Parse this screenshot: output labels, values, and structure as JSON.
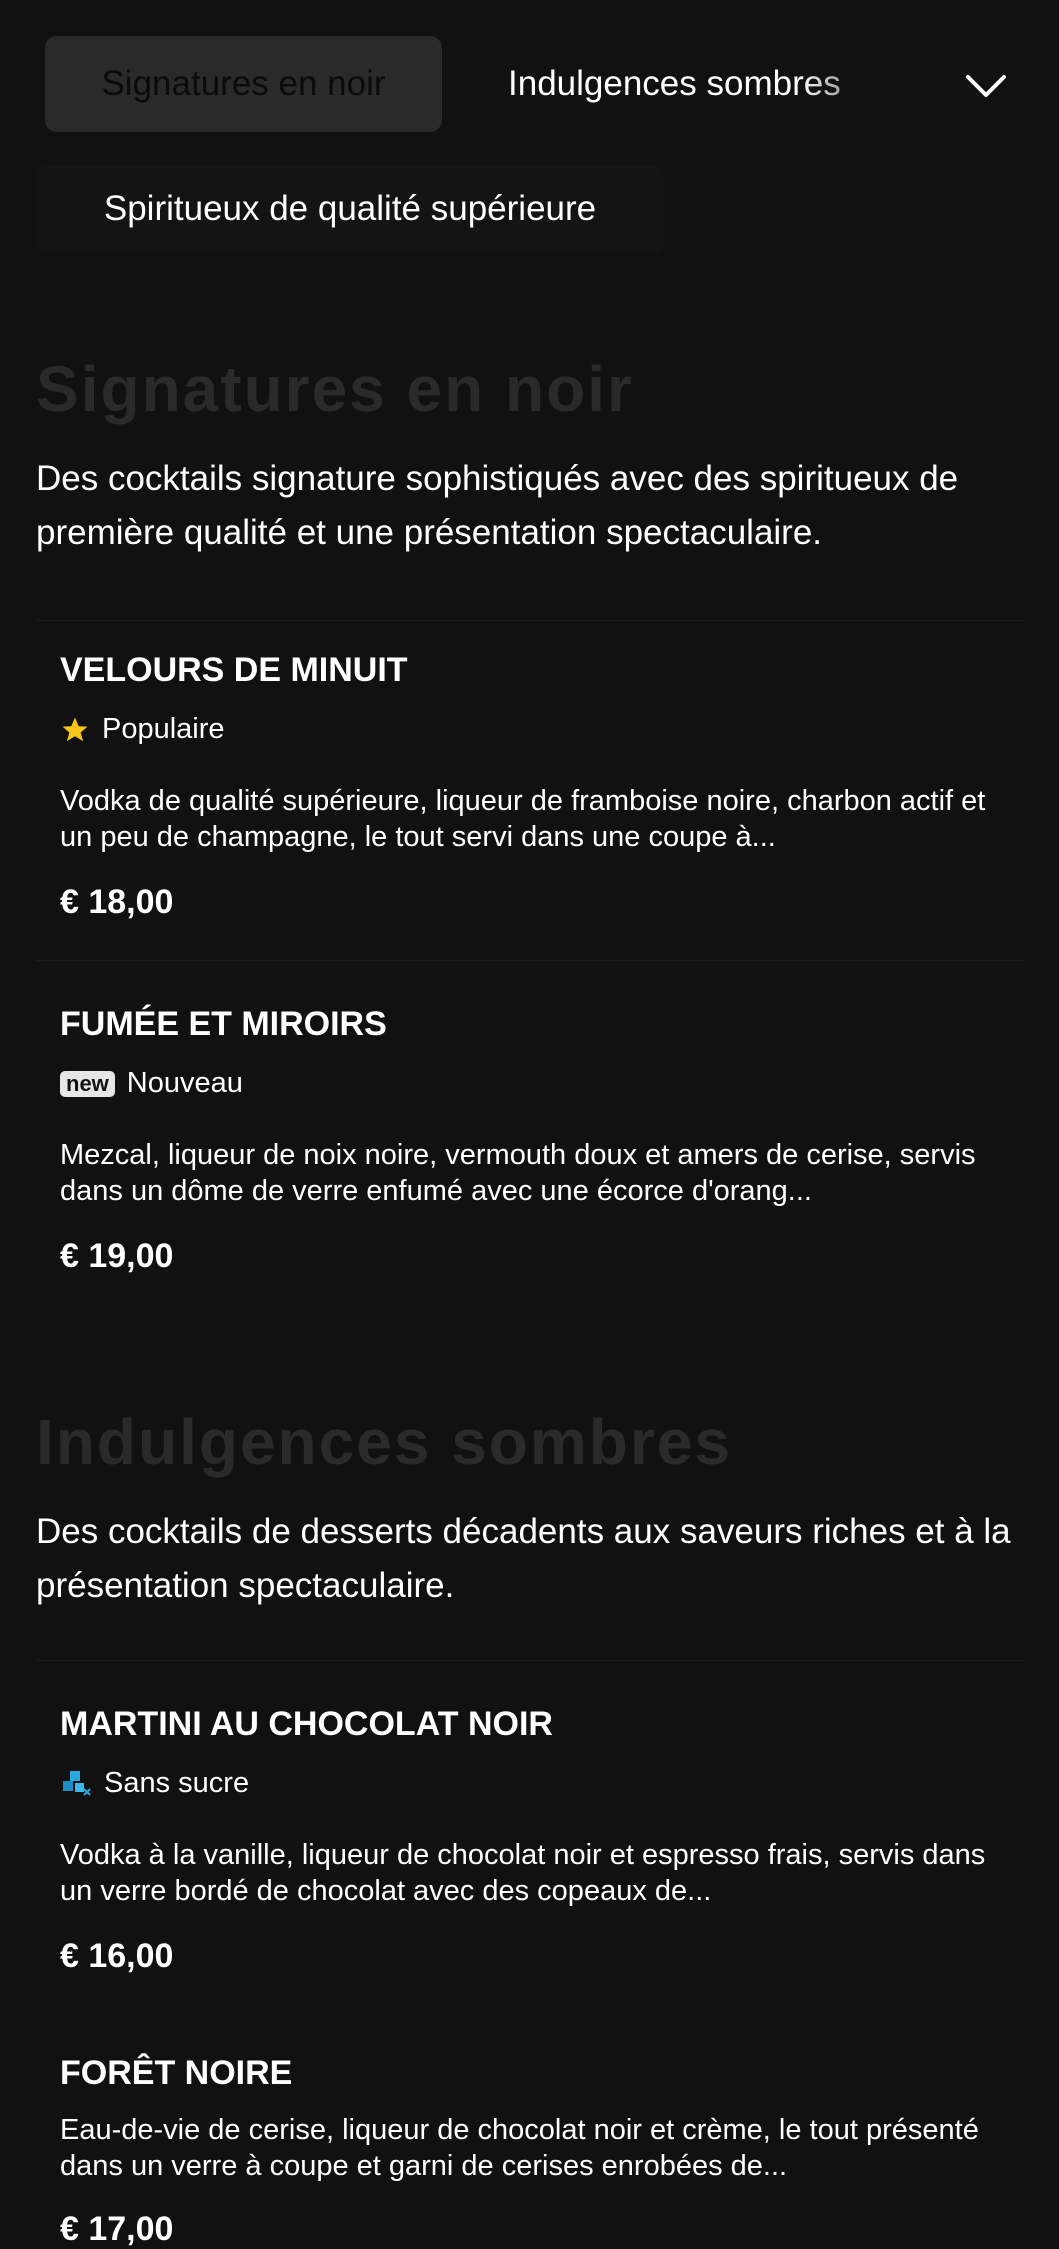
{
  "categories": {
    "tabs": [
      "Signatures en noir",
      "Indulgences sombres",
      "Spiritueux de qualité supérieure"
    ],
    "active_index": 0,
    "expand_icon": "chevron-down-icon"
  },
  "sections": [
    {
      "title": "Signatures en noir",
      "description": "Des cocktails signature sophistiqués avec des spiritueux de première qualité et une présentation spectaculaire.",
      "items": [
        {
          "name": "VELOURS DE MINUIT",
          "tag": {
            "icon": "star-icon",
            "label": "Populaire"
          },
          "description": "Vodka de qualité supérieure, liqueur de framboise noire, charbon actif et un peu de champagne, le tout servi dans une coupe à...",
          "price": "€ 18,00"
        },
        {
          "name": "FUMÉE ET MIROIRS",
          "tag": {
            "icon": "new-badge-icon",
            "badge_text": "new",
            "label": "Nouveau"
          },
          "description": "Mezcal, liqueur de noix noire, vermouth doux et amers de cerise, servis dans un dôme de verre enfumé avec une écorce d'orang...",
          "price": "€ 19,00"
        }
      ]
    },
    {
      "title": "Indulgences sombres",
      "description": "Des cocktails de desserts décadents aux saveurs riches et à la présentation spectaculaire.",
      "items": [
        {
          "name": "MARTINI AU CHOCOLAT NOIR",
          "tag": {
            "icon": "sugar-free-icon",
            "label": "Sans sucre"
          },
          "description": "Vodka à la vanille, liqueur de chocolat noir et espresso frais, servis dans un verre bordé de chocolat avec des copeaux de...",
          "price": "€ 16,00"
        },
        {
          "name": "FORÊT NOIRE",
          "description": "Eau-de-vie de cerise, liqueur de chocolat noir et crème, le tout présenté dans un verre à coupe et garni de cerises enrobées de...",
          "price": "€ 17,00"
        }
      ]
    }
  ],
  "colors": {
    "background": "#111111",
    "active_tab": "#2a2a2a",
    "section_title": "#2a2a2a",
    "star": "#f5c518",
    "sugar_free": "#29a8e0"
  }
}
